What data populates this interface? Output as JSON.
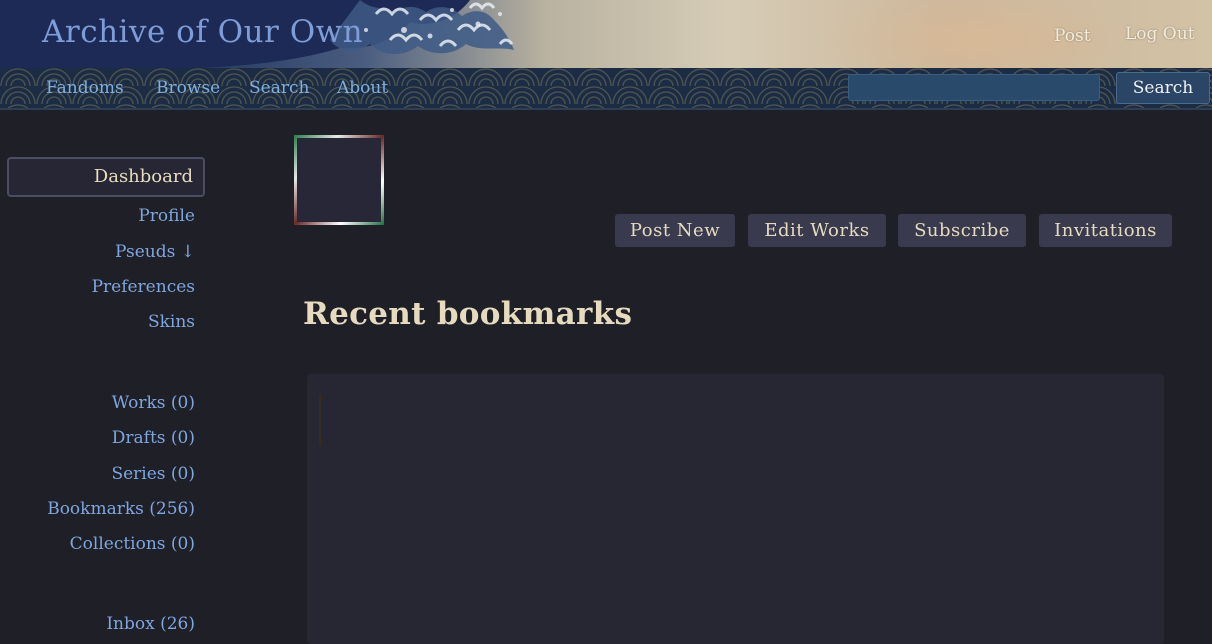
{
  "header": {
    "site_title": "Archive of Our Own",
    "links": [
      "Post",
      "Log Out"
    ]
  },
  "nav": {
    "items": [
      "Fandoms",
      "Browse",
      "Search",
      "About"
    ],
    "search_value": "",
    "search_button": "Search"
  },
  "sidebar": {
    "dashboard": "Dashboard",
    "items": [
      "Profile",
      "Pseuds ↓",
      "Preferences",
      "Skins"
    ],
    "counts": [
      "Works (0)",
      "Drafts (0)",
      "Series (0)",
      "Bookmarks (256)",
      "Collections (0)"
    ],
    "inbox": "Inbox (26)"
  },
  "actions": [
    "Post New",
    "Edit Works",
    "Subscribe",
    "Invitations"
  ],
  "main": {
    "heading": "Recent bookmarks"
  },
  "colors": {
    "background": "#1f1f28",
    "heading": "#e6dbbf",
    "link": "#7fa6de",
    "nav_bg": "#1c2c45",
    "button_bg": "#3a3a4e"
  }
}
